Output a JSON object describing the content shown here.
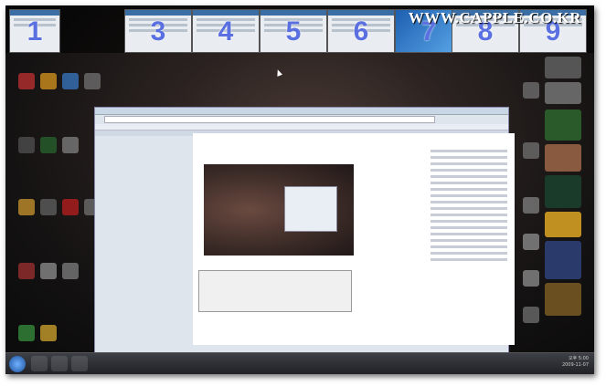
{
  "watermark": "WWW.CAPPLE.CO.KR",
  "thumbnails": [
    "1",
    "3",
    "4",
    "5",
    "6",
    "7",
    "8",
    "9"
  ],
  "taskbar": {
    "clock_time": "오후 5:00",
    "clock_date": "2009-11-07"
  },
  "colors": {
    "thumb_number": "#5a6fe0",
    "taskbar": "#2a2c30"
  }
}
